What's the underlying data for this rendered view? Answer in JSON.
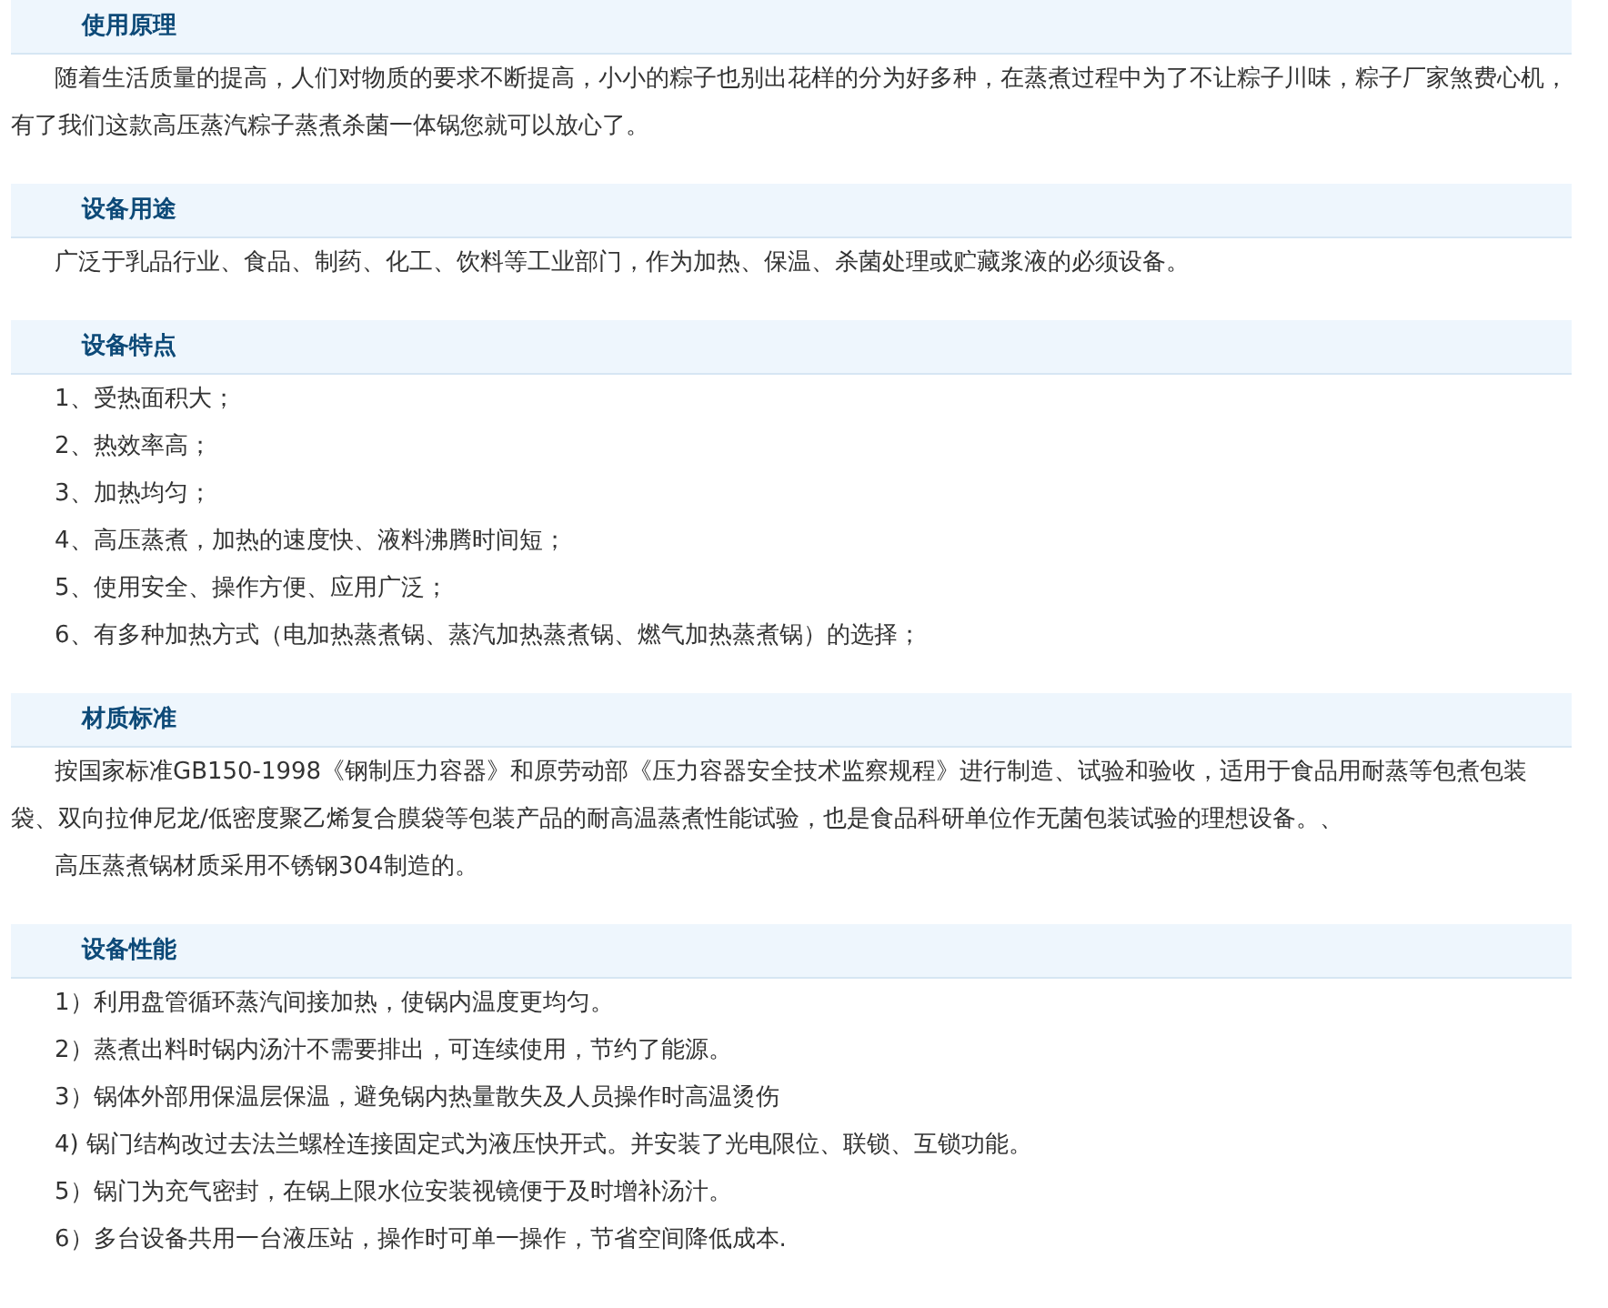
{
  "sections": [
    {
      "title": "使用原理",
      "kind": "paragraphs",
      "paragraphs": [
        "随着生活质量的提高，人们对物质的要求不断提高，小小的粽子也别出花样的分为好多种，在蒸煮过程中为了不让粽子川味，粽子厂家煞费心机，有了我们这款高压蒸汽粽子蒸煮杀菌一体锅您就可以放心了。"
      ]
    },
    {
      "title": "设备用途",
      "kind": "paragraphs",
      "paragraphs": [
        "广泛于乳品行业、食品、制药、化工、饮料等工业部门，作为加热、保温、杀菌处理或贮藏浆液的必须设备。"
      ]
    },
    {
      "title": "设备特点",
      "kind": "list",
      "items": [
        "1、受热面积大；",
        "2、热效率高；",
        "3、加热均匀；",
        "4、高压蒸煮，加热的速度快、液料沸腾时间短；",
        "5、使用安全、操作方便、应用广泛；",
        "6、有多种加热方式（电加热蒸煮锅、蒸汽加热蒸煮锅、燃气加热蒸煮锅）的选择；"
      ]
    },
    {
      "title": "材质标准",
      "kind": "paragraphs",
      "paragraphs": [
        "按国家标准GB150-1998《钢制压力容器》和原劳动部《压力容器安全技术监察规程》进行制造、试验和验收，适用于食品用耐蒸等包煮包装袋、双向拉伸尼龙/低密度聚乙烯复合膜袋等包装产品的耐高温蒸煮性能试验，也是食品科研单位作无菌包装试验的理想设备。、",
        "高压蒸煮锅材质采用不锈钢304制造的。"
      ]
    },
    {
      "title": "设备性能",
      "kind": "list",
      "items": [
        "1）利用盘管循环蒸汽间接加热，使锅内温度更均匀。",
        "2）蒸煮出料时锅内汤汁不需要排出，可连续使用，节约了能源。",
        "3）锅体外部用保温层保温，避免锅内热量散失及人员操作时高温烫伤",
        "4) 锅门结构改过去法兰螺栓连接固定式为液压快开式。并安装了光电限位、联锁、互锁功能。",
        "5）锅门为充气密封，在锅上限水位安装视镜便于及时增补汤汁。",
        "6）多台设备共用一台液压站，操作时可单一操作，节省空间降低成本."
      ]
    }
  ]
}
